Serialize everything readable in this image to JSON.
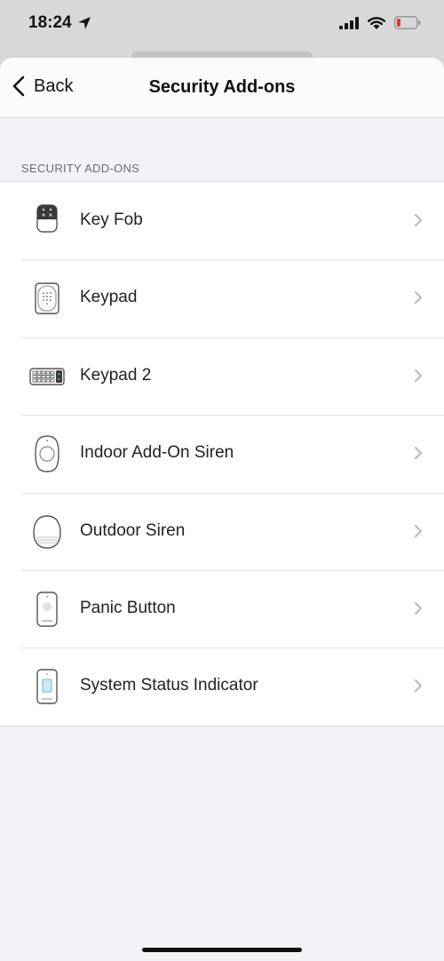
{
  "status_bar": {
    "time": "18:24",
    "battery_color": "#e53935"
  },
  "nav": {
    "back_label": "Back",
    "title": "Security Add-ons"
  },
  "section": {
    "header": "SECURITY ADD-ONS"
  },
  "items": [
    {
      "label": "Key Fob",
      "icon": "key-fob-icon"
    },
    {
      "label": "Keypad",
      "icon": "keypad-icon"
    },
    {
      "label": "Keypad 2",
      "icon": "keypad-2-icon"
    },
    {
      "label": "Indoor Add-On Siren",
      "icon": "indoor-siren-icon"
    },
    {
      "label": "Outdoor Siren",
      "icon": "outdoor-siren-icon"
    },
    {
      "label": "Panic Button",
      "icon": "panic-button-icon"
    },
    {
      "label": "System Status Indicator",
      "icon": "status-indicator-icon"
    }
  ]
}
